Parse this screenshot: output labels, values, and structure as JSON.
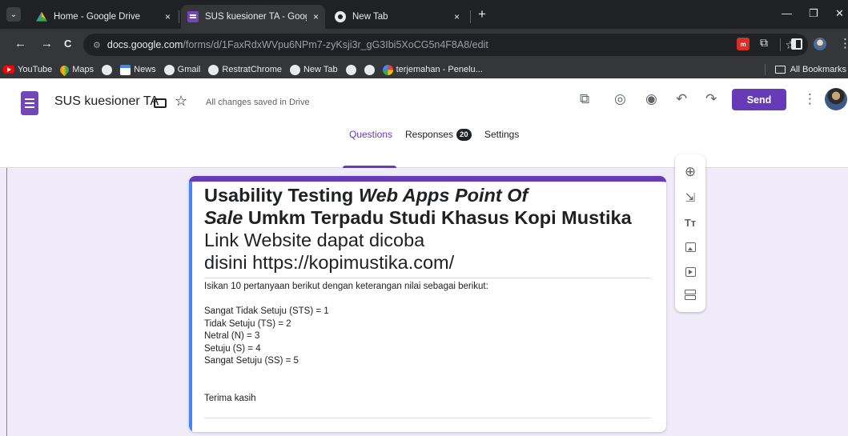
{
  "browser": {
    "tabs": [
      {
        "title": "Home - Google Drive",
        "close": "×"
      },
      {
        "title": "SUS kuesioner TA - Google Forms",
        "close": "×"
      },
      {
        "title": "New Tab",
        "close": "×"
      }
    ],
    "new_tab": "+",
    "window_controls": {
      "minimize": "—",
      "restore": "❐",
      "close": "✕"
    },
    "nav": {
      "back": "←",
      "forward": "→",
      "reload": "C"
    },
    "url_domain": "docs.google.com",
    "url_path": "/forms/d/1FaxRdxWVpu6NPm7-zyKsji3r_gG3Ibi5XoCG5n4F8A8/edit",
    "bookmarks": [
      {
        "label": "YouTube",
        "icon": "youtube-icon"
      },
      {
        "label": "Maps",
        "icon": "maps-icon"
      },
      {
        "label": "",
        "icon": "chrome-icon"
      },
      {
        "label": "News",
        "icon": "news-icon"
      },
      {
        "label": "Gmail",
        "icon": "chrome-icon"
      },
      {
        "label": "RestratChrome",
        "icon": "chrome-icon"
      },
      {
        "label": "New Tab",
        "icon": "chrome-icon"
      },
      {
        "label": "",
        "icon": "chrome-icon"
      },
      {
        "label": "",
        "icon": "chrome-icon"
      },
      {
        "label": "terjemahan - Penelu...",
        "icon": "google-icon"
      }
    ],
    "all_bookmarks": "All Bookmarks"
  },
  "header": {
    "form_title": "SUS kuesioner TA",
    "save_status": "All changes saved in Drive",
    "send_label": "Send",
    "tabs": [
      {
        "label": "Questions",
        "active": true
      },
      {
        "label": "Responses",
        "badge": "20"
      },
      {
        "label": "Settings"
      }
    ]
  },
  "form": {
    "title_lines": [
      {
        "parts": [
          {
            "t": "Usability Testing  ",
            "style": "bold"
          },
          {
            "t": "Web Apps Point Of",
            "style": "bi"
          }
        ]
      },
      {
        "parts": [
          {
            "t": "Sale",
            "style": "bi"
          },
          {
            "t": " Umkm Terpadu Studi Khasus Kopi Mustika",
            "style": "bold"
          }
        ]
      },
      {
        "parts": [
          {
            "t": "Link Website dapat dicoba",
            "style": "normal"
          }
        ]
      },
      {
        "parts": [
          {
            "t": "disini https://kopimustika.com/",
            "style": "normal"
          }
        ]
      }
    ],
    "description_lines": [
      "Isikan 10 pertanyaan berikut dengan keterangan nilai sebagai berikut:",
      "",
      "Sangat Tidak Setuju (STS) = 1",
      "Tidak Setuju (TS) = 2",
      "Netral (N) = 3",
      "Setuju (S) = 4",
      "Sangat Setuju (SS) = 5",
      "",
      "",
      "Terima kasih"
    ]
  },
  "toolbar": {
    "items": [
      {
        "name": "add-question",
        "icon": "add-circle-icon"
      },
      {
        "name": "import-questions",
        "icon": "import-icon"
      },
      {
        "name": "add-title-description",
        "icon": "text-icon"
      },
      {
        "name": "add-image",
        "icon": "image-icon"
      },
      {
        "name": "add-video",
        "icon": "video-icon"
      },
      {
        "name": "add-section",
        "icon": "section-icon"
      }
    ]
  },
  "colors": {
    "accent": "#673ab7",
    "background": "#f0ebf8",
    "chrome_dark": "#202124"
  }
}
